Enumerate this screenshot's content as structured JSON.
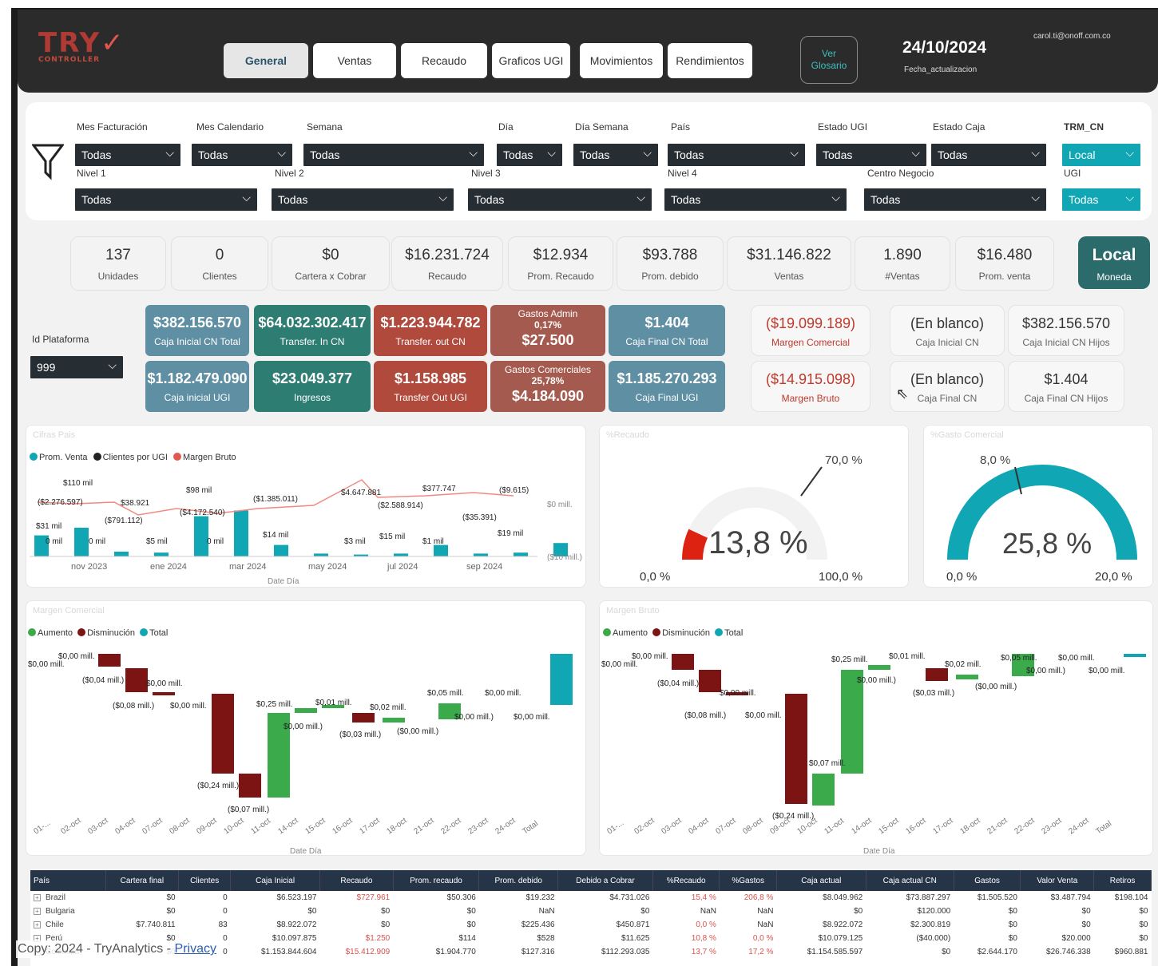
{
  "header": {
    "logo_main": "TRY",
    "logo_mark": "✓",
    "logo_sub": "CONTROLLER",
    "tabs": [
      "General",
      "Ventas",
      "Recaudo",
      "Graficos UGI",
      "Movimientos",
      "Rendimientos"
    ],
    "glossary_line1": "Ver",
    "glossary_line2": "Glosario",
    "date": "24/10/2024",
    "date_label": "Fecha_actualizacion",
    "email": "carol.ti@onoff.com.co"
  },
  "filters": {
    "row1": [
      {
        "label": "Mes Facturación",
        "value": "Todas"
      },
      {
        "label": "Mes Calendario",
        "value": "Todas"
      },
      {
        "label": "Semana",
        "value": "Todas"
      },
      {
        "label": "Día",
        "value": "Todas"
      },
      {
        "label": "Día Semana",
        "value": "Todas"
      },
      {
        "label": "País",
        "value": "Todas"
      },
      {
        "label": "Estado UGI",
        "value": "Todas"
      },
      {
        "label": "Estado Caja",
        "value": "Todas"
      },
      {
        "label": "TRM_CN",
        "value": "Local"
      }
    ],
    "row2": [
      {
        "label": "Nivel 1",
        "value": "Todas"
      },
      {
        "label": "Nivel 2",
        "value": "Todas"
      },
      {
        "label": "Nivel 3",
        "value": "Todas"
      },
      {
        "label": "Nivel 4",
        "value": "Todas"
      },
      {
        "label": "Centro Negocio",
        "value": "Todas"
      },
      {
        "label": "UGI",
        "value": "Todas"
      }
    ]
  },
  "kpis": [
    {
      "value": "137",
      "label": "Unidades"
    },
    {
      "value": "0",
      "label": "Clientes"
    },
    {
      "value": "$0",
      "label": "Cartera x Cobrar"
    },
    {
      "value": "$16.231.724",
      "label": "Recaudo"
    },
    {
      "value": "$12.934",
      "label": "Prom. Recaudo"
    },
    {
      "value": "$93.788",
      "label": "Prom. debido"
    },
    {
      "value": "$31.146.822",
      "label": "Ventas"
    },
    {
      "value": "1.890",
      "label": "#Ventas"
    },
    {
      "value": "$16.480",
      "label": "Prom. venta"
    }
  ],
  "moneda": {
    "value": "Local",
    "label": "Moneda"
  },
  "plataforma": {
    "label": "Id Plataforma",
    "value": "999"
  },
  "tiles": {
    "caja_inicial_total": {
      "value": "$382.156.570",
      "label": "Caja Inicial CN Total"
    },
    "transfer_in": {
      "value": "$64.032.302.417",
      "label": "Transfer. In CN"
    },
    "transfer_out": {
      "value": "$1.223.944.782",
      "label": "Transfer. out CN"
    },
    "gastos_admin": {
      "title": "Gastos Admin",
      "pct": "0,17%",
      "value": "$27.500"
    },
    "caja_final_total": {
      "value": "$1.404",
      "label": "Caja Final CN Total"
    },
    "caja_inicial_ugi": {
      "value": "$1.182.479.090",
      "label": "Caja inicial UGI"
    },
    "ingresos": {
      "value": "$23.049.377",
      "label": "Ingresos"
    },
    "transfer_out_ugi": {
      "value": "$1.158.985",
      "label": "Transfer Out UGI"
    },
    "gastos_comerciales": {
      "title": "Gastos Comerciales",
      "pct": "25,78%",
      "value": "$4.184.090"
    },
    "caja_final_ugi": {
      "value": "$1.185.270.293",
      "label": "Caja Final UGI"
    },
    "margen_comercial": {
      "value": "($19.099.189)",
      "label": "Margen Comercial"
    },
    "margen_bruto": {
      "value": "($14.915.098)",
      "label": "Margen Bruto"
    },
    "caja_inicial_cn": {
      "value": "(En blanco)",
      "label": "Caja Inicial CN"
    },
    "caja_inicial_hijos": {
      "value": "$382.156.570",
      "label": "Caja Inicial CN Hijos"
    },
    "caja_final_cn": {
      "value": "(En blanco)",
      "label": "Caja Final CN"
    },
    "caja_final_hijos": {
      "value": "$1.404",
      "label": "Caja Final CN Hijos"
    }
  },
  "colors": {
    "teal": "#10a6b3",
    "dark": "#2b2b2b",
    "red": "#c0392b",
    "green": "#3aaa4a",
    "maroon": "#7d1414"
  },
  "chart_data": [
    {
      "type": "bar",
      "title": "Cifras Pais",
      "legend": [
        "Prom. Venta",
        "Clientes por UGI",
        "Margen Bruto"
      ],
      "xlabel": "Date Día",
      "x_ticks": [
        "nov 2023",
        "ene 2024",
        "mar 2024",
        "may 2024",
        "jul 2024",
        "sep 2024"
      ],
      "right_axis": [
        "$0 mill.",
        "($10 mill.)"
      ],
      "labels": [
        "$110 mil",
        "($2.276.597)",
        "$38.921",
        "$98 mil",
        "($1.385.011)",
        "$4.647.881",
        "$377.747",
        "($9.615)",
        "$31 mil",
        "($791.112)",
        "($4.172.540)",
        "($2.588.914)",
        "($35.391)",
        "0 mil",
        "0 mil",
        "$5 mil",
        "0 mil",
        "$14 mil",
        "$3 mil",
        "$15 mil",
        "$1 mil",
        "$19 mil"
      ],
      "bars": [
        22,
        30,
        5,
        4,
        42,
        48,
        12,
        3,
        2,
        3,
        12,
        3,
        4,
        14
      ]
    },
    {
      "type": "gauge",
      "title": "%Recaudo",
      "value": "13,8 %",
      "min": "0,0 %",
      "max": "100,0 %",
      "target": "70,0 %",
      "fraction": 0.138
    },
    {
      "type": "gauge",
      "title": "%Gasto Comercial",
      "value": "25,8 %",
      "min": "0,0 %",
      "max": "20,0 %",
      "target": "8,0 %",
      "fraction": 1.0
    },
    {
      "type": "waterfall",
      "title": "Margen Comercial",
      "legend": [
        "Aumento",
        "Disminución",
        "Total"
      ],
      "xlabel": "Date Día",
      "x_ticks": [
        "01-...",
        "02-oct",
        "03-oct",
        "04-oct",
        "07-oct",
        "08-oct",
        "09-oct",
        "10-oct",
        "11-oct",
        "14-oct",
        "15-oct",
        "16-oct",
        "17-oct",
        "18-oct",
        "21-oct",
        "22-oct",
        "23-oct",
        "24-oct",
        "Total"
      ],
      "labels": [
        "$0,00 mill.",
        "$0,00 mill.",
        "($0,04 mill.)",
        "$0,00 mill.",
        "($0,08 mill.)",
        "$0,00 mill.",
        "($0,24 mill.)",
        "($0,07 mill.)",
        "$0,25 mill.",
        "$0,00 mill.)",
        "$0,01 mill.",
        "($0,03 mill.)",
        "$0,02 mill.",
        "($0,00 mill.)",
        "$0,05 mill.",
        "$0,00 mill.)",
        "$0,00 mill.",
        "$0,00 mill."
      ]
    },
    {
      "type": "waterfall",
      "title": "Margen Bruto",
      "legend": [
        "Aumento",
        "Disminución",
        "Total"
      ],
      "xlabel": "Date Día",
      "x_ticks": [
        "01-...",
        "02-oct",
        "03-oct",
        "04-oct",
        "07-oct",
        "08-oct",
        "09-oct",
        "10-oct",
        "11-oct",
        "14-oct",
        "15-oct",
        "16-oct",
        "17-oct",
        "18-oct",
        "21-oct",
        "22-oct",
        "23-oct",
        "24-oct",
        "Total"
      ],
      "labels": [
        "$0,00 mill.",
        "$0,00 mill.",
        "($0,04 mill.)",
        "$0,00 mill.",
        "($0,08 mill.)",
        "$0,00 mill.",
        "$0,07 mill.",
        "($0,24 mill.)",
        "$0,25 mill.",
        "$0,00 mill.)",
        "$0,01 mill.",
        "($0,03 mill.)",
        "$0,02 mill.",
        "($0,00 mill.)",
        "$0,05 mill.",
        "$0,00 mill.)",
        "$0,00 mill.",
        "$0,00 mill."
      ]
    }
  ],
  "table": {
    "columns": [
      "País",
      "Cartera final",
      "Clientes",
      "Caja Inicial",
      "Recaudo",
      "Prom. recaudo",
      "Prom. debido",
      "Debido a Cobrar",
      "%Recaudo",
      "%Gastos",
      "Caja actual",
      "Caja actual CN",
      "Gastos",
      "Valor Venta",
      "Retiros"
    ],
    "rows": [
      [
        "Brazil",
        "$0",
        "0",
        "$6.523.197",
        "$727.961",
        "$50.306",
        "$19.232",
        "$4.731.026",
        "15,4 %",
        "206,8 %",
        "$8.049.962",
        "$73.887.297",
        "$1.505.520",
        "$3.487.794",
        "$198.104"
      ],
      [
        "Bulgaria",
        "$0",
        "0",
        "$0",
        "$0",
        "$0",
        "NaN",
        "$0",
        "NaN",
        "NaN",
        "$0",
        "$120.000",
        "$0",
        "$0",
        "$0"
      ],
      [
        "Chile",
        "$7.740.811",
        "83",
        "$8.922.072",
        "$0",
        "$0",
        "$225.436",
        "$450.871",
        "0,0 %",
        "NaN",
        "$8.922.072",
        "$2.300.819",
        "$0",
        "$0",
        "$0"
      ],
      [
        "Perú",
        "$0",
        "0",
        "$10.097.875",
        "$1.250",
        "$114",
        "$528",
        "$11.625",
        "10,8 %",
        "0,0 %",
        "$10.079.125",
        "($40.000)",
        "$0",
        "$20.000",
        "$0"
      ],
      [
        "Colombia",
        "$0",
        "0",
        "$1.153.844.604",
        "$15.412.909",
        "$1.904.770",
        "$127.316",
        "$112.293.035",
        "13,7 %",
        "17,2 %",
        "$1.154.585.597",
        "$0",
        "$2.644.170",
        "$26.746.338",
        "$960.881"
      ]
    ]
  },
  "footer": {
    "text": "Copy: 2024 - TryAnalytics - ",
    "link": "Privacy"
  }
}
